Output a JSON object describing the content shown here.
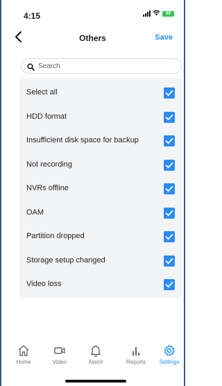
{
  "status_bar": {
    "time": "4:15",
    "battery": "69"
  },
  "nav": {
    "title": "Others",
    "save_label": "Save"
  },
  "search": {
    "placeholder": "Search",
    "value": ""
  },
  "list": {
    "items": [
      {
        "label": "Select all",
        "checked": true
      },
      {
        "label": "HDD format",
        "checked": true
      },
      {
        "label": "Insufficient disk space for backup",
        "checked": true
      },
      {
        "label": "Not recording",
        "checked": true
      },
      {
        "label": "NVRs offline",
        "checked": true
      },
      {
        "label": "OAM",
        "checked": true
      },
      {
        "label": "Partition dropped",
        "checked": true
      },
      {
        "label": "Storage setup changed",
        "checked": true
      },
      {
        "label": "Video loss",
        "checked": true
      }
    ]
  },
  "tabbar": {
    "tabs": [
      {
        "label": "Home",
        "icon": "home-icon"
      },
      {
        "label": "Video",
        "icon": "video-icon"
      },
      {
        "label": "Alarm",
        "icon": "bell-icon"
      },
      {
        "label": "Reports",
        "icon": "bar-chart-icon"
      },
      {
        "label": "Settings",
        "icon": "gear-icon",
        "active": true
      }
    ]
  },
  "colors": {
    "accent": "#1f8fff",
    "checkbox": "#2b8cf7",
    "list_bg": "#f3f4f6"
  }
}
